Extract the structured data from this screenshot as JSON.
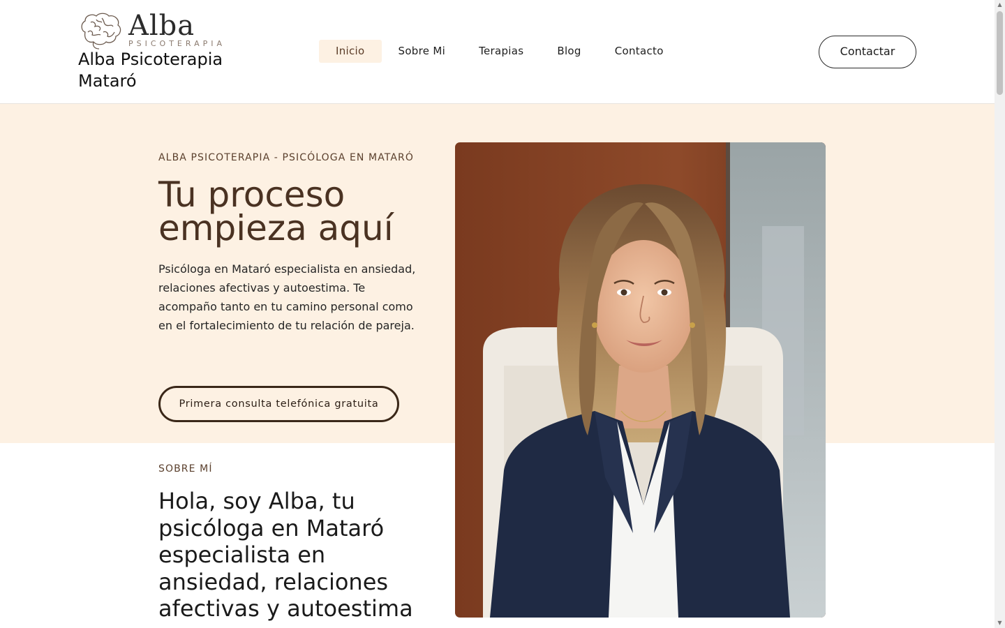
{
  "header": {
    "logo": {
      "word": "Alba",
      "sub": "PSICOTERAPIA"
    },
    "site_title_line1": "Alba Psicoterapia",
    "site_title_line2": "Mataró",
    "nav": [
      {
        "label": "Inicio",
        "active": true
      },
      {
        "label": "Sobre Mi",
        "active": false
      },
      {
        "label": "Terapias",
        "active": false
      },
      {
        "label": "Blog",
        "active": false
      },
      {
        "label": "Contacto",
        "active": false
      }
    ],
    "contact_button": "Contactar"
  },
  "hero": {
    "eyebrow": "ALBA PSICOTERAPIA - PSICÓLOGA EN MATARÓ",
    "title_line1": "Tu proceso",
    "title_line2": "empieza aquí",
    "text": "Psicóloga en Mataró especialista en ansiedad, relaciones afectivas y autoestima. Te acompaño tanto en tu camino personal como en el fortalecimiento de tu relación de pareja.",
    "cta": "Primera consulta telefónica gratuita"
  },
  "about": {
    "eyebrow": "SOBRE MÍ",
    "title": "Hola, soy Alba, tu psicóloga en Mataró especialista en ansiedad, relaciones afectivas y autoestima"
  },
  "colors": {
    "hero_bg": "#fdf1e3",
    "brown_dark": "#4a3222",
    "brown_accent": "#5a3f2c",
    "active_nav_bg": "#fdf1e3"
  },
  "icons": {
    "logo": "brain-icon",
    "scroll_up": "triangle-up-icon",
    "scroll_down": "triangle-down-icon"
  }
}
